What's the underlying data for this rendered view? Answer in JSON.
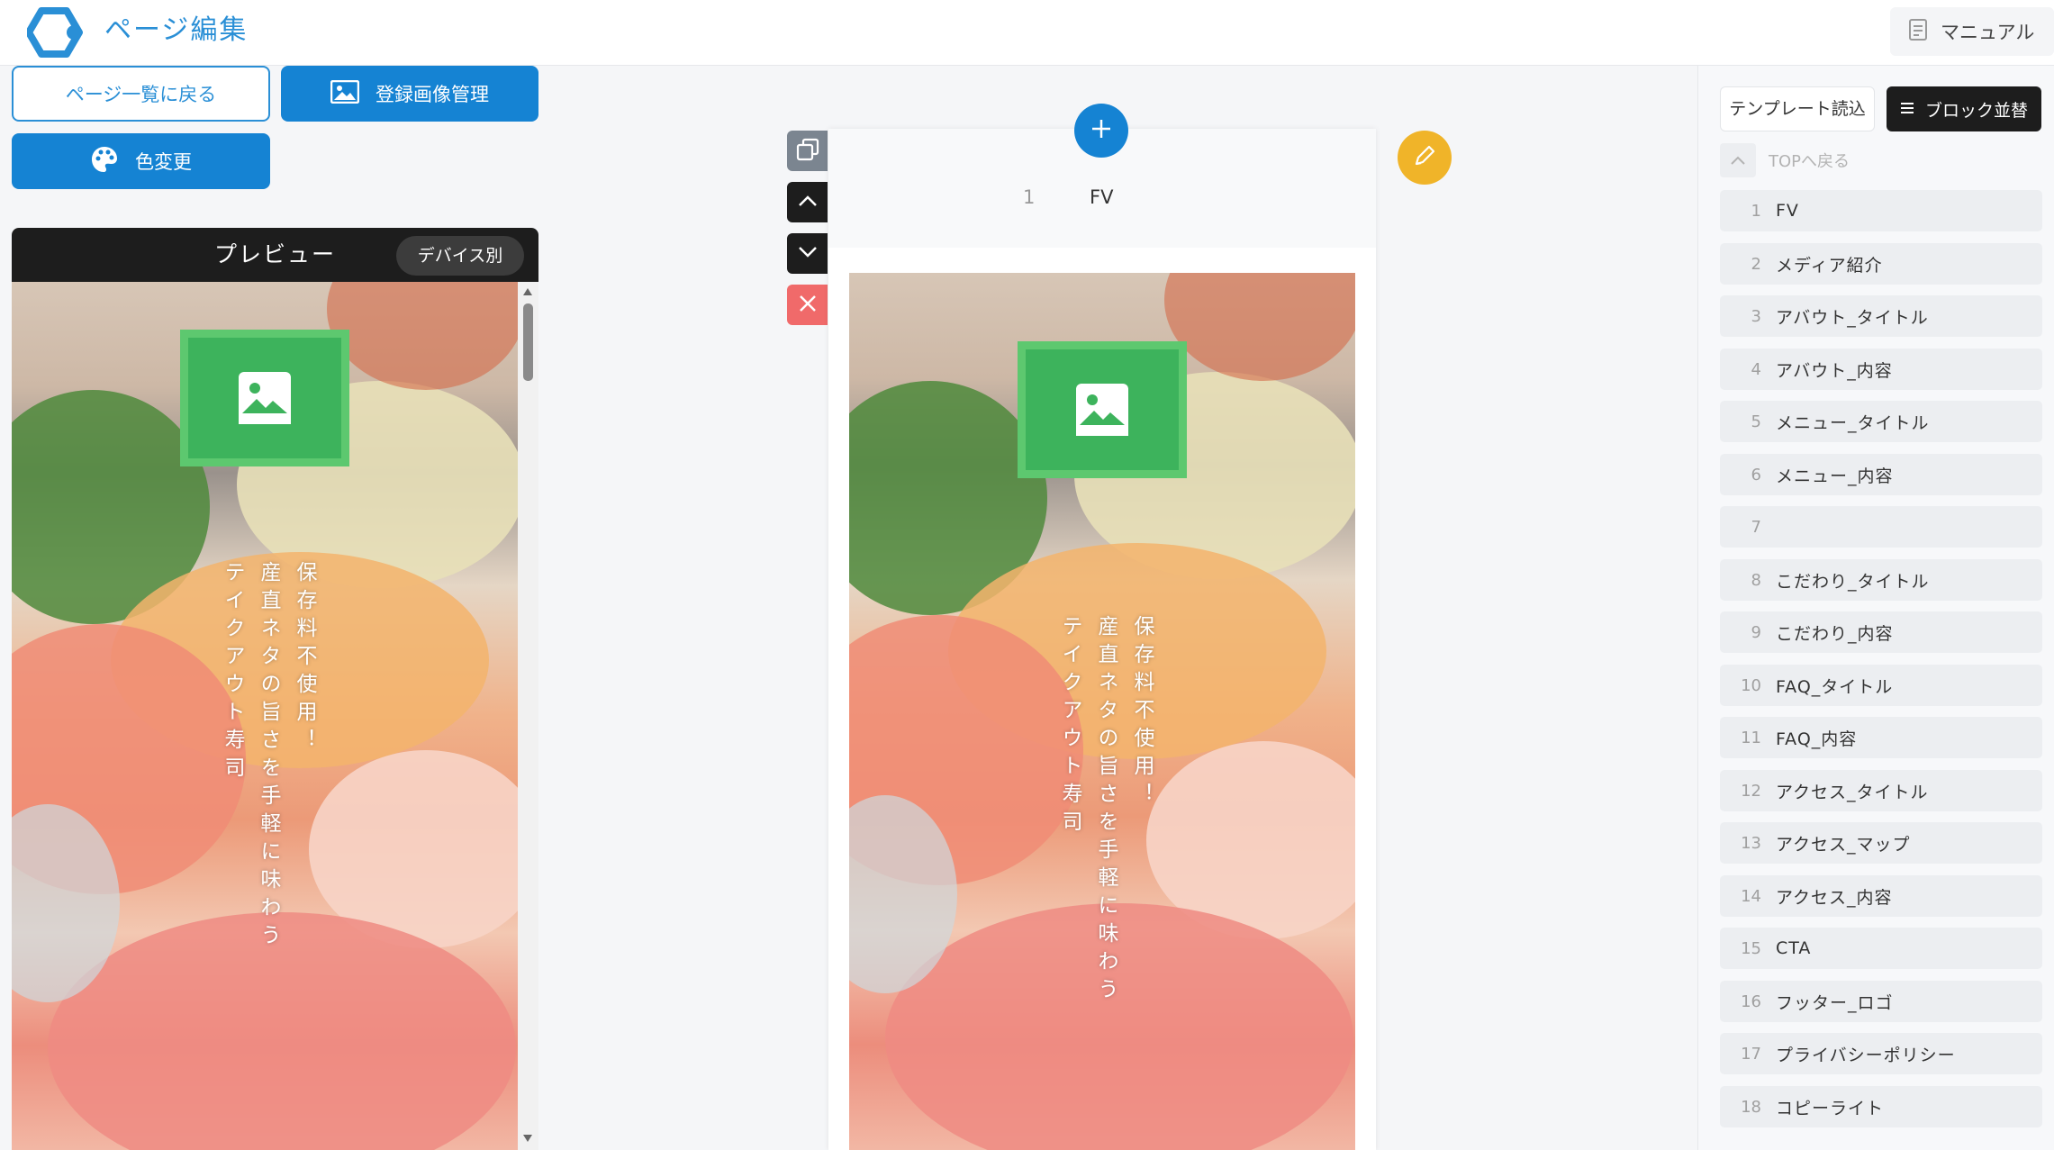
{
  "header": {
    "title": "ページ編集",
    "manual_label": "マニュアル"
  },
  "left": {
    "back_label": "ページ一覧に戻る",
    "images_label": "登録画像管理",
    "color_label": "色変更"
  },
  "preview": {
    "title": "プレビュー",
    "device_label": "デバイス別",
    "headline": "保存料不使用！",
    "subline": "産直ネタの旨さを手軽に味わう",
    "tagline": "テイクアウト寿司"
  },
  "editor": {
    "block_number": "1",
    "block_name": "FV"
  },
  "right": {
    "template_label": "テンプレート読込",
    "sort_label": "ブロック並替",
    "top_back_label": "TOPへ戻る",
    "blocks": [
      {
        "num": "1",
        "label": "FV"
      },
      {
        "num": "2",
        "label": "メディア紹介"
      },
      {
        "num": "3",
        "label": "アバウト_タイトル"
      },
      {
        "num": "4",
        "label": "アバウト_内容"
      },
      {
        "num": "5",
        "label": "メニュー_タイトル"
      },
      {
        "num": "6",
        "label": "メニュー_内容"
      },
      {
        "num": "7",
        "label": ""
      },
      {
        "num": "8",
        "label": "こだわり_タイトル"
      },
      {
        "num": "9",
        "label": "こだわり_内容"
      },
      {
        "num": "10",
        "label": "FAQ_タイトル"
      },
      {
        "num": "11",
        "label": "FAQ_内容"
      },
      {
        "num": "12",
        "label": "アクセス_タイトル"
      },
      {
        "num": "13",
        "label": "アクセス_マップ"
      },
      {
        "num": "14",
        "label": "アクセス_内容"
      },
      {
        "num": "15",
        "label": "CTA"
      },
      {
        "num": "16",
        "label": "フッター_ロゴ"
      },
      {
        "num": "17",
        "label": "プライバシーポリシー"
      },
      {
        "num": "18",
        "label": "コピーライト"
      }
    ]
  },
  "colors": {
    "accent": "#1583d3",
    "dark": "#1d1d1d",
    "delete": "#f06a6a",
    "edit": "#f0b429",
    "placeholder": "#3db35c"
  },
  "icons": [
    "app-logo-icon",
    "manual-icon",
    "image-icon",
    "palette-icon",
    "plus-icon",
    "pencil-icon",
    "copy-icon",
    "chevron-up-icon",
    "chevron-down-icon",
    "close-icon",
    "menu-icon"
  ]
}
